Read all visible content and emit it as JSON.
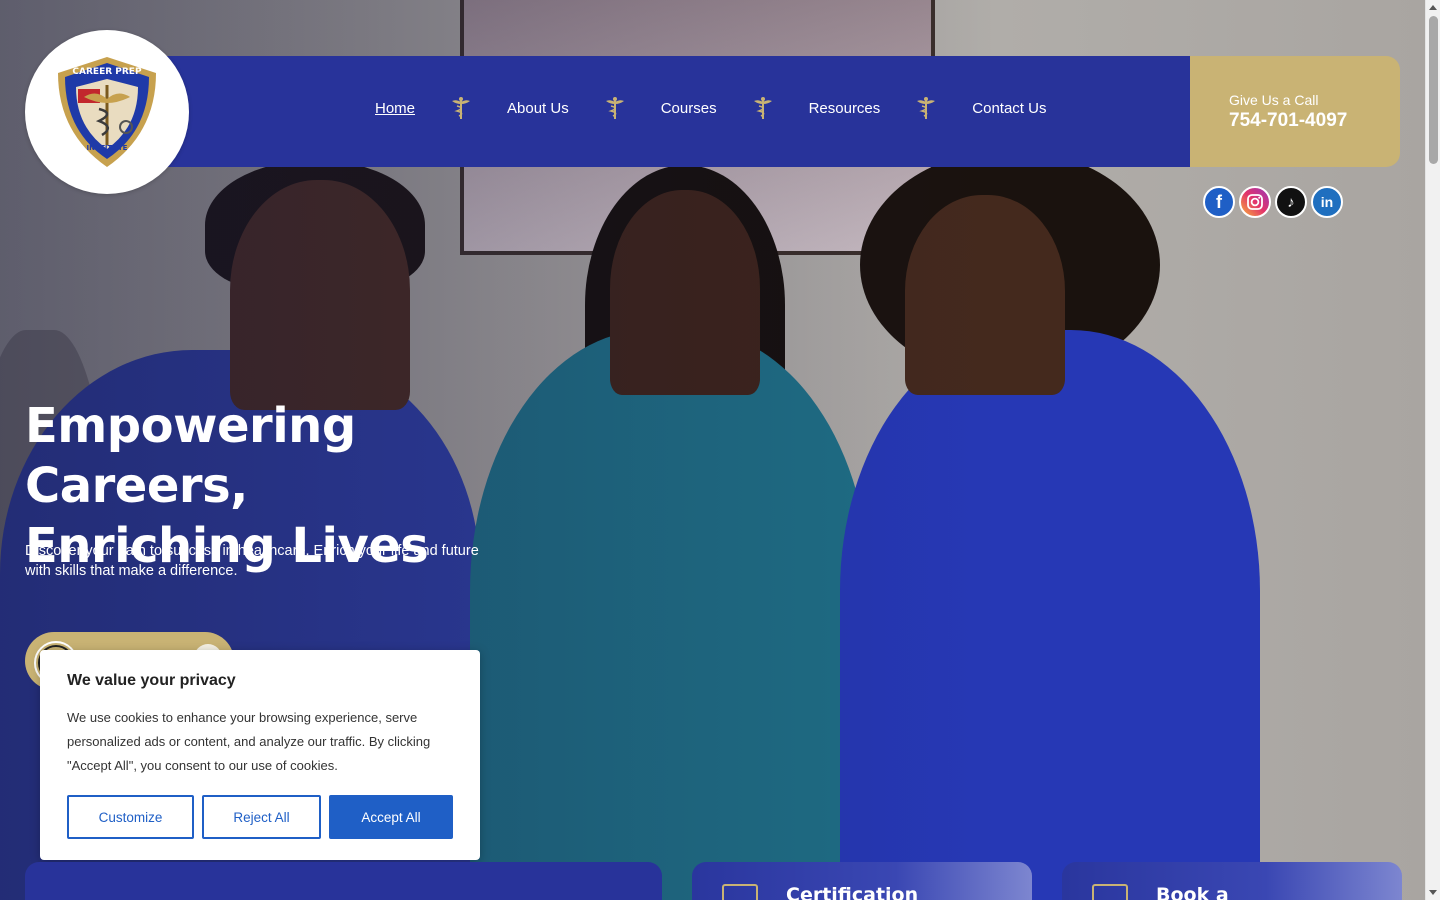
{
  "header": {
    "nav": [
      {
        "label": "Home",
        "active": true
      },
      {
        "label": "About Us",
        "active": false
      },
      {
        "label": "Courses",
        "active": false
      },
      {
        "label": "Resources",
        "active": false
      },
      {
        "label": "Contact Us",
        "active": false
      }
    ],
    "logo": {
      "text_top": "CAREER PREP",
      "text_bottom": "INSTITUTE"
    },
    "call": {
      "label": "Give Us a Call",
      "number": "754-701-4097"
    },
    "socials": [
      "facebook-icon",
      "instagram-icon",
      "tiktok-icon",
      "linkedin-icon"
    ]
  },
  "hero": {
    "title_line1": "Empowering Careers,",
    "title_line2": "Enriching Lives",
    "subtitle": "Discover your path to success in healthcare. Enrich your life and future with skills that make a difference."
  },
  "cookie": {
    "title": "We value your privacy",
    "text": "We use cookies to enhance your browsing experience, serve personalized ads or content, and analyze our traffic. By clicking \"Accept All\", you consent to our use of cookies.",
    "customize": "Customize",
    "reject": "Reject All",
    "accept": "Accept All"
  },
  "cards": [
    {
      "title": "Certification",
      "icon": "certificate-icon"
    },
    {
      "title": "Book a",
      "icon": "calendar-icon"
    }
  ],
  "colors": {
    "brand_blue": "#28339a",
    "gold": "#c9b374",
    "cookie_blue": "#1f5fc6"
  }
}
